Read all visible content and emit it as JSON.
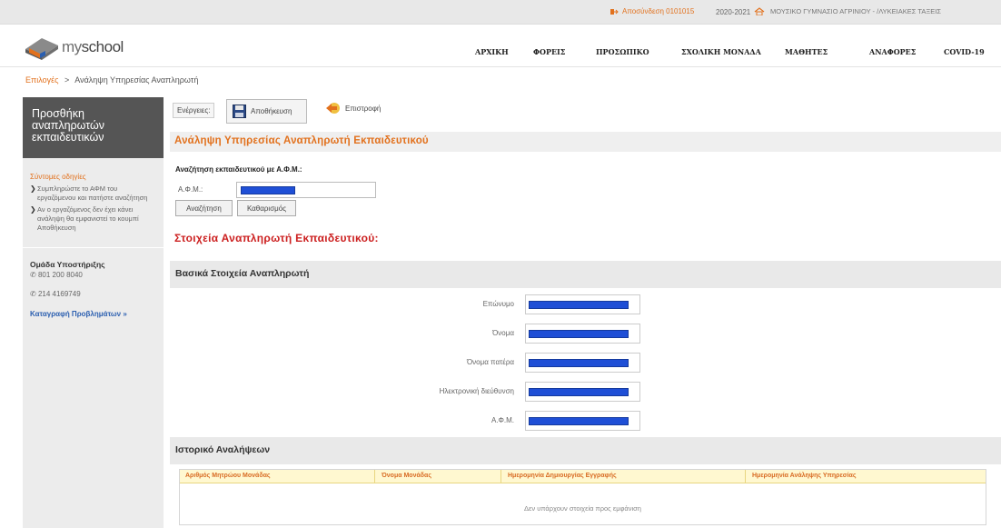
{
  "topbar": {
    "logout": "Αποσύνδεση 0101015",
    "year": "2020-2021",
    "school": "ΜΟΥΣΙΚΟ ΓΥΜΝΑΣΙΟ ΑΓΡΙΝΙΟΥ - /ΛΥΚΕΙΑΚΕΣ ΤΑΞΕΙΣ"
  },
  "brand": {
    "prefix": "my",
    "suffix": "school"
  },
  "nav": [
    "ΑΡΧΙΚΗ",
    "ΦΟΡΕΙΣ",
    "ΠΡΟΣΩΠΙΚΟ",
    "ΣΧΟΛΙΚΗ ΜΟΝΑΔΑ",
    "ΜΑΘΗΤΕΣ",
    "ΑΝΑΦΟΡΕΣ",
    "COVID-19"
  ],
  "breadcrumb": {
    "link": "Επιλογές",
    "sep": ">",
    "current": "Ανάληψη Υπηρεσίας Αναπληρωτή"
  },
  "sidebar": {
    "title": "Προσθήκη αναπληρωτών εκπαιδευτικών",
    "help_title": "Σύντομες οδηγίες",
    "help_items": [
      "Συμπληρώστε το ΑΦΜ του εργαζόμενου και πατήστε αναζήτηση",
      "Αν ο εργαζόμενος δεν έχει κάνει ανάληψη θα εμφανιστεί το κουμπί Αποθήκευση"
    ],
    "support_title": "Ομάδα Υποστήριξης",
    "phone1": "801 200 8040",
    "phone2": "214 4169749",
    "report_link": "Καταγραφή Προβλημάτων »"
  },
  "toolbar": {
    "actions_label": "Ενέργειες:",
    "save": "Αποθήκευση",
    "back": "Επιστροφή"
  },
  "page_title": "Ανάληψη Υπηρεσίας Αναπληρωτή Εκπαιδευτικού",
  "search": {
    "heading": "Αναζήτηση εκπαιδευτικού με Α.Φ.Μ.:",
    "afm_label": "Α.Φ.Μ.:",
    "search_button": "Αναζήτηση",
    "clear_button": "Καθαρισμός"
  },
  "details_title": "Στοιχεία Αναπληρωτή Εκπαιδευτικού:",
  "basic_section": {
    "title": "Βασικά Στοιχεία Αναπληρωτή",
    "fields": [
      "Επώνυμο",
      "Όνομα",
      "Όνομα πατέρα",
      "Ηλεκτρονική διεύθυνση",
      "Α.Φ.Μ."
    ]
  },
  "history_section": {
    "title": "Ιστορικό Αναλήψεων",
    "columns": [
      "Αριθμός Μητρώου Μονάδας",
      "Όνομα Μονάδας",
      "Ημερομηνία Δημιουργίας Εγγραφής",
      "Ημερομηνία Ανάληψης Υπηρεσίας"
    ],
    "empty": "Δεν υπάρχουν στοιχεία προς εμφάνιση"
  },
  "colors": {
    "accent": "#e2711d",
    "redact": "#1f4fd6",
    "details_title": "#cc2020",
    "link": "#2b5fb0"
  }
}
